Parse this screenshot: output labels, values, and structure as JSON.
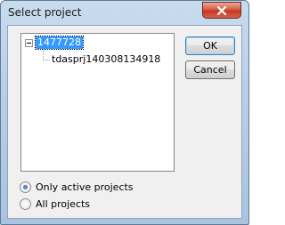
{
  "window": {
    "title": "Select project"
  },
  "tree": {
    "root": {
      "label": "1477728",
      "expanded": true,
      "selected": true,
      "children": [
        {
          "label": "tdasprj140308134918"
        }
      ]
    }
  },
  "buttons": {
    "ok_label": "OK",
    "cancel_label": "Cancel"
  },
  "filter": {
    "selected": "only_active",
    "options": [
      {
        "id": "only_active",
        "label": "Only active projects",
        "checked": true
      },
      {
        "id": "all",
        "label": "All projects",
        "checked": false
      }
    ]
  },
  "icons": {
    "close": "close-icon",
    "expander": "tree-collapse-icon"
  },
  "colors": {
    "selection": "#3399ff",
    "close_button": "#c2351d",
    "default_button_border": "#3c7fb1"
  }
}
